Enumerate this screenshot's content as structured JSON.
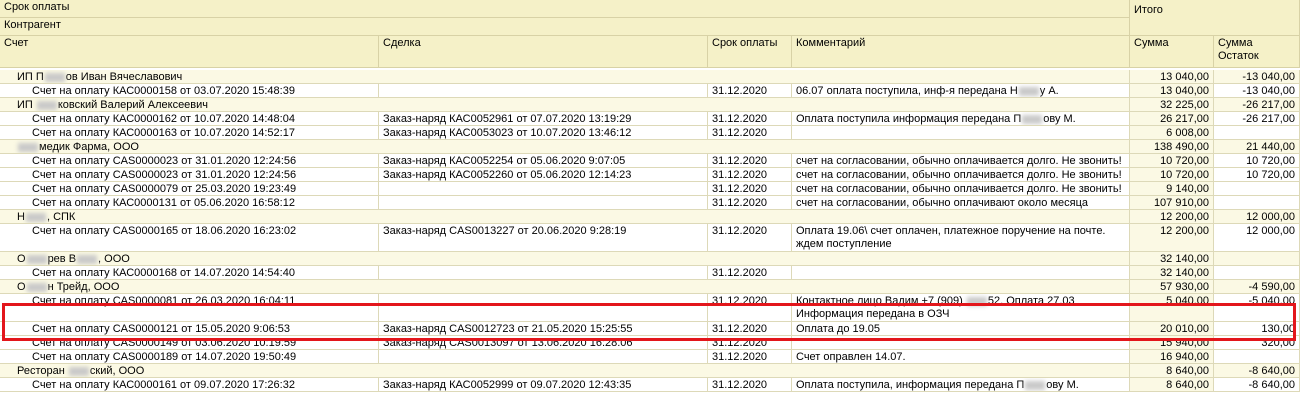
{
  "header": {
    "srok_oplaty_top": "Срок оплаты",
    "kontragent": "Контрагент",
    "itogo": "Итого",
    "schet": "Счет",
    "sdelka": "Сделка",
    "srok_oplaty": "Срок оплаты",
    "kommentariy": "Комментарий",
    "summa": "Сумма",
    "summa_ostatok_1": "Сумма",
    "summa_ostatok_2": "Остаток"
  },
  "rows": [
    {
      "type": "group",
      "name_pre": "ИП П",
      "name_post": "ов Иван Вячеславович",
      "sum": "13 040,00",
      "ost": "-13 040,00"
    },
    {
      "type": "detail",
      "schet": "Счет на оплату КАС0000158 от 03.07.2020 15:48:39",
      "sdelka": "",
      "srok": "31.12.2020",
      "comm_pre": "06.07 оплата поступила, инф-я передана Н",
      "comm_post": "у А.",
      "sum": "13 040,00",
      "ost": "-13 040,00"
    },
    {
      "type": "group",
      "name_pre": "ИП ",
      "name_post": "ковский Валерий Алексеевич",
      "sum": "32 225,00",
      "ost": "-26 217,00"
    },
    {
      "type": "detail",
      "schet": "Счет на оплату КАС0000162 от 10.07.2020 14:48:04",
      "sdelka": "Заказ-наряд КАС0052961 от 07.07.2020 13:19:29",
      "srok": "31.12.2020",
      "comm_pre": "Оплата поступила информация передана П",
      "comm_post": "ову М.",
      "sum": "26 217,00",
      "ost": "-26 217,00"
    },
    {
      "type": "detail",
      "schet": "Счет на оплату КАС0000163 от 10.07.2020 14:52:17",
      "sdelka": "Заказ-наряд КАС0053023 от 10.07.2020 13:46:12",
      "srok": "31.12.2020",
      "comm": "",
      "sum": "6 008,00",
      "ost": ""
    },
    {
      "type": "group",
      "name_pre": "",
      "name_post": "медик Фарма, ООО",
      "sum": "138 490,00",
      "ost": "21 440,00"
    },
    {
      "type": "detail",
      "schet": "Счет на оплату CAS0000023 от 31.01.2020 12:24:56",
      "sdelka": "Заказ-наряд КАС0052254 от 05.06.2020 9:07:05",
      "srok": "31.12.2020",
      "comm": "счет на согласовании, обычно оплачивается долго. Не звонить!",
      "sum": "10 720,00",
      "ost": "10 720,00"
    },
    {
      "type": "detail",
      "schet": "Счет на оплату CAS0000023 от 31.01.2020 12:24:56",
      "sdelka": "Заказ-наряд КАС0052260 от 05.06.2020 12:14:23",
      "srok": "31.12.2020",
      "comm": "счет на согласовании, обычно оплачивается долго. Не звонить!",
      "sum": "10 720,00",
      "ost": "10 720,00"
    },
    {
      "type": "detail",
      "schet": "Счет на оплату CAS0000079 от 25.03.2020 19:23:49",
      "sdelka": "",
      "srok": "31.12.2020",
      "comm": "счет на согласовании, обычно оплачивается долго. Не звонить!",
      "sum": "9 140,00",
      "ost": ""
    },
    {
      "type": "detail",
      "schet": "Счет на оплату КАС0000131 от 05.06.2020 16:58:12",
      "sdelka": "",
      "srok": "31.12.2020",
      "comm": "счет на согласовании, обычно оплачивают около месяца",
      "sum": "107 910,00",
      "ost": ""
    },
    {
      "type": "group",
      "name_pre": "Н",
      "name_post": ", СПК",
      "sum": "12 200,00",
      "ost": "12 000,00"
    },
    {
      "type": "detail2",
      "schet": "Счет на оплату CAS0000165 от 18.06.2020 16:23:02",
      "sdelka": "Заказ-наряд CAS0013227 от 20.06.2020 9:28:19",
      "srok": "31.12.2020",
      "comm_line1": "Оплата 19.06\\ счет оплачен, платежное поручение на почте.",
      "comm_line2": "ждем поступление",
      "sum": "12 200,00",
      "ost": "12 000,00"
    },
    {
      "type": "group",
      "name_pre": "О",
      "name_mid": "рев В",
      "name_post": ", ООО",
      "sum": "32 140,00",
      "ost": ""
    },
    {
      "type": "detail",
      "schet": "Счет на оплату КАС0000168 от 14.07.2020 14:54:40",
      "sdelka": "",
      "srok": "31.12.2020",
      "comm": "",
      "sum": "32 140,00",
      "ost": ""
    },
    {
      "type": "group",
      "name_pre": "О",
      "name_post": "н Трейд, ООО",
      "sum": "57 930,00",
      "ost": "-4 590,00"
    },
    {
      "type": "detail2",
      "schet": "Счет на оплату CAS0000081 от 26.03.2020 16:04:11",
      "sdelka": "",
      "srok": "31.12.2020",
      "comm_line1_pre": "Контактное лицо Вадим +7 (909) ",
      "comm_line1_post": "52. Оплата 27.03",
      "comm_line2": "Информация передана в ОЗЧ",
      "sum": "5 040,00",
      "ost": "-5 040,00"
    },
    {
      "type": "detail",
      "schet": "Счет на оплату CAS0000121 от 15.05.2020 9:06:53",
      "sdelka": "Заказ-наряд CAS0012723 от 21.05.2020 15:25:55",
      "srok": "31.12.2020",
      "comm": "Оплата до 19.05",
      "sum": "20 010,00",
      "ost": "130,00"
    },
    {
      "type": "detail",
      "schet": "Счет на оплату CAS0000149 от 03.06.2020 10:19:59",
      "sdelka": "Заказ-наряд CAS0013097 от 13.06.2020 16:28:06",
      "srok": "31.12.2020",
      "comm": "",
      "sum": "15 940,00",
      "ost": "320,00"
    },
    {
      "type": "detail",
      "schet": "Счет на оплату CAS0000189 от 14.07.2020 19:50:49",
      "sdelka": "",
      "srok": "31.12.2020",
      "comm": "Счет оправлен 14.07.",
      "sum": "16 940,00",
      "ost": ""
    },
    {
      "type": "group",
      "name_pre": "Ресторан ",
      "name_post": "ский, ООО",
      "sum": "8 640,00",
      "ost": "-8 640,00"
    },
    {
      "type": "detail",
      "schet": "Счет на оплату КАС0000161 от 09.07.2020 17:26:32",
      "sdelka": "Заказ-наряд КАС0052999 от 09.07.2020 12:43:35",
      "srok": "31.12.2020",
      "comm_pre": "Оплата поступила, информация передана П",
      "comm_post": "ову М.",
      "sum": "8 640,00",
      "ost": "-8 640,00"
    }
  ],
  "colors": {
    "header_bg": "#f5f1c8",
    "group_bg": "#fbf9e4",
    "highlight": "#e3161b"
  }
}
